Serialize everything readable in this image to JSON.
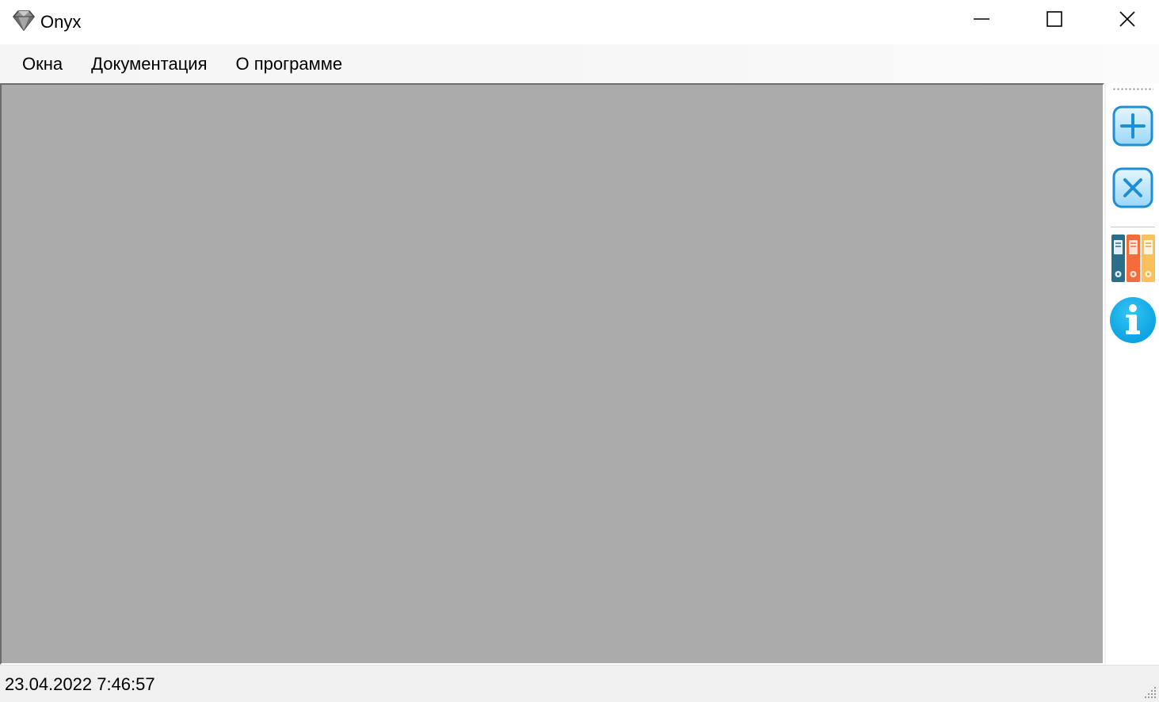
{
  "window": {
    "title": "Onyx",
    "icon": "diamond-icon",
    "controls": {
      "minimize_icon": "minimize-icon",
      "maximize_icon": "maximize-icon",
      "close_icon": "close-icon"
    }
  },
  "menu": {
    "items": [
      {
        "label": "Окна"
      },
      {
        "label": "Документация"
      },
      {
        "label": "О программе"
      }
    ]
  },
  "workspace": {
    "background_color": "#ababab"
  },
  "toolbar": {
    "buttons": [
      {
        "icon": "add-window-icon",
        "accent": "#1fa0e0"
      },
      {
        "icon": "close-window-icon",
        "accent": "#1fa0e0"
      },
      {
        "icon": "binders-icon",
        "colors": [
          "#2a6f8a",
          "#f36c3a",
          "#fbbf5b"
        ]
      },
      {
        "icon": "info-icon",
        "accent": "#0ea5e9"
      }
    ]
  },
  "statusbar": {
    "datetime": "23.04.2022 7:46:57"
  }
}
